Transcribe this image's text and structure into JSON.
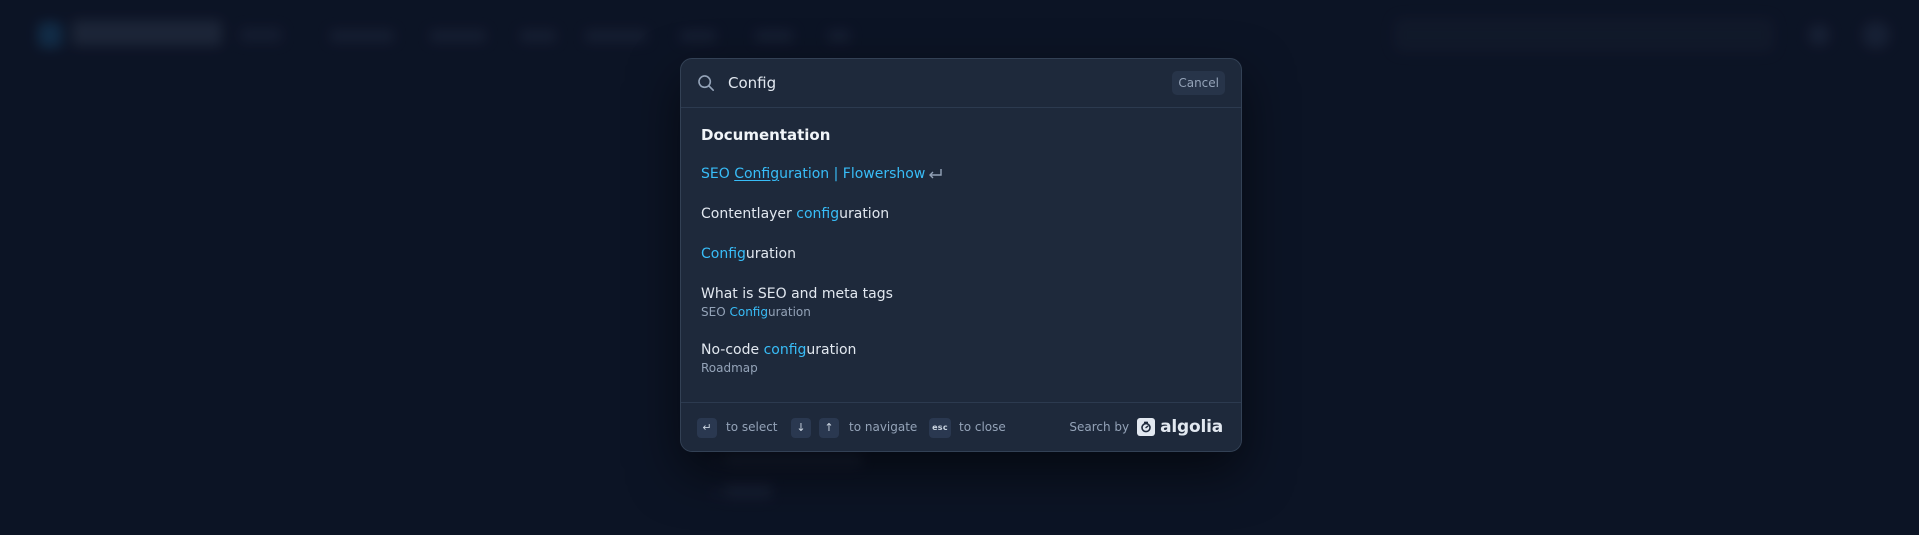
{
  "search": {
    "query": "Config",
    "cancel_label": "Cancel"
  },
  "results": {
    "section_title": "Documentation",
    "hits": [
      {
        "title_prefix": "SEO ",
        "title_highlight": "Config",
        "title_suffix": "uration | Flowershow",
        "subtitle_prefix": "",
        "subtitle_highlight": "",
        "subtitle_suffix": "",
        "selected": true
      },
      {
        "title_prefix": "Contentlayer ",
        "title_highlight": "config",
        "title_suffix": "uration",
        "subtitle_prefix": "",
        "subtitle_highlight": "",
        "subtitle_suffix": ""
      },
      {
        "title_prefix": "",
        "title_highlight": "Config",
        "title_suffix": "uration",
        "subtitle_prefix": "",
        "subtitle_highlight": "",
        "subtitle_suffix": ""
      },
      {
        "title_prefix": "What is SEO and meta tags",
        "title_highlight": "",
        "title_suffix": "",
        "subtitle_prefix": "SEO ",
        "subtitle_highlight": "Config",
        "subtitle_suffix": "uration"
      },
      {
        "title_prefix": "No-code ",
        "title_highlight": "config",
        "title_suffix": "uration",
        "subtitle_prefix": "Roadmap",
        "subtitle_highlight": "",
        "subtitle_suffix": ""
      }
    ]
  },
  "footer": {
    "select_label": "to select",
    "navigate_label": "to navigate",
    "close_label": "to close",
    "esc_key": "esc",
    "enter_key": "↵",
    "down_key": "↓",
    "up_key": "↑",
    "search_by_label": "Search by",
    "brand": "algolia"
  },
  "colors": {
    "page_background": "#0f172a",
    "modal_background": "#1e293b",
    "highlight": "#38bdf8"
  },
  "icons": {
    "search": "search-icon",
    "enter": "enter-icon",
    "algolia": "algolia-icon"
  }
}
